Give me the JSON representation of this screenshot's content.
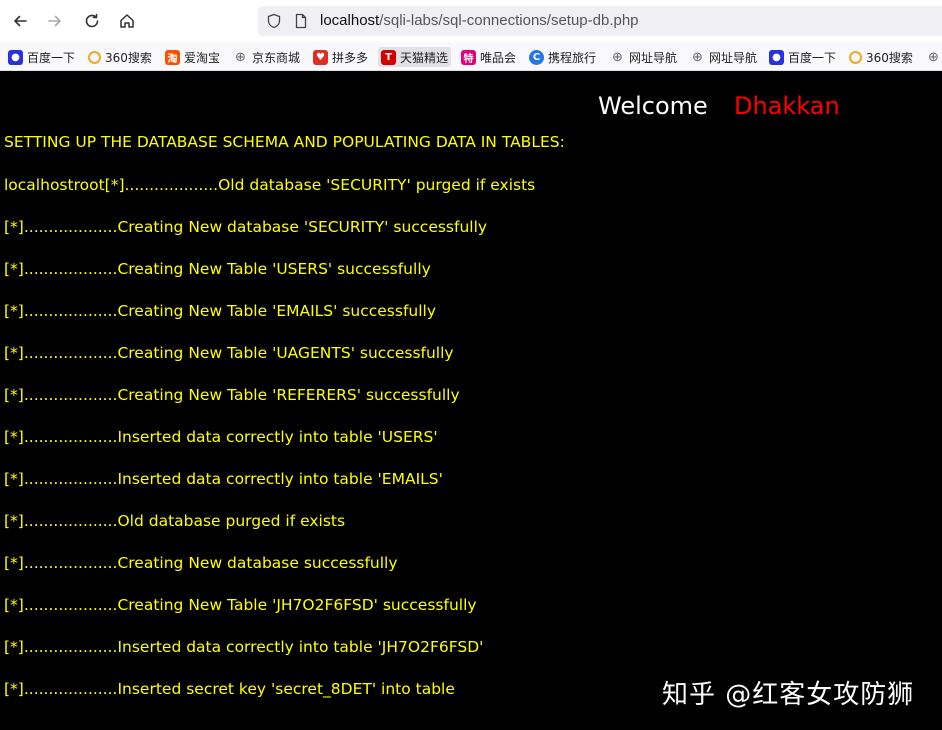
{
  "browser": {
    "url_host": "localhost",
    "url_path": "/sqli-labs/sql-connections/setup-db.php",
    "bookmarks": [
      {
        "label": "百度一下",
        "icon": "baidu-paw-icon",
        "color": "#2932e1"
      },
      {
        "label": "360搜索",
        "icon": "360-search-icon",
        "color": "#f5a623"
      },
      {
        "label": "爱淘宝",
        "icon": "taobao-icon",
        "color": "#ff5000"
      },
      {
        "label": "京东商城",
        "icon": "globe-icon",
        "color": "#666666"
      },
      {
        "label": "拼多多",
        "icon": "pinduoduo-icon",
        "color": "#e02e24"
      },
      {
        "label": "天猫精选",
        "icon": "tmall-icon",
        "color": "#d40000"
      },
      {
        "label": "唯品会",
        "icon": "vip-icon",
        "color": "#e4007f"
      },
      {
        "label": "携程旅行",
        "icon": "ctrip-icon",
        "color": "#2577e3"
      },
      {
        "label": "网址导航",
        "icon": "globe-icon",
        "color": "#666666"
      },
      {
        "label": "网址导航",
        "icon": "globe-icon",
        "color": "#666666"
      },
      {
        "label": "百度一下",
        "icon": "baidu-paw-icon",
        "color": "#2932e1"
      },
      {
        "label": "360搜索",
        "icon": "360-search-icon",
        "color": "#f5a623"
      }
    ]
  },
  "page": {
    "welcome": "Welcome",
    "user": "Dhakkan",
    "heading": "SETTING UP THE DATABASE SCHEMA AND POPULATING DATA IN TABLES:",
    "log": [
      "localhostroot[*]...................Old database 'SECURITY' purged if exists",
      "[*]...................Creating New database 'SECURITY' successfully",
      "[*]...................Creating New Table 'USERS' successfully",
      "[*]...................Creating New Table 'EMAILS' successfully",
      "[*]...................Creating New Table 'UAGENTS' successfully",
      "[*]...................Creating New Table 'REFERERS' successfully",
      "[*]...................Inserted data correctly into table 'USERS'",
      "[*]...................Inserted data correctly into table 'EMAILS'",
      "[*]...................Old database purged if exists",
      "[*]...................Creating New database successfully",
      "[*]...................Creating New Table 'JH7O2F6FSD' successfully",
      "[*]...................Inserted data correctly into table 'JH7O2F6FSD'",
      "[*]...................Inserted secret key 'secret_8DET' into table"
    ],
    "watermark": "知乎 @红客女攻防狮"
  },
  "colors": {
    "page_bg": "#000000",
    "text_yellow": "#ffff00",
    "welcome_white": "#ffffff",
    "user_red": "#ff0000"
  }
}
